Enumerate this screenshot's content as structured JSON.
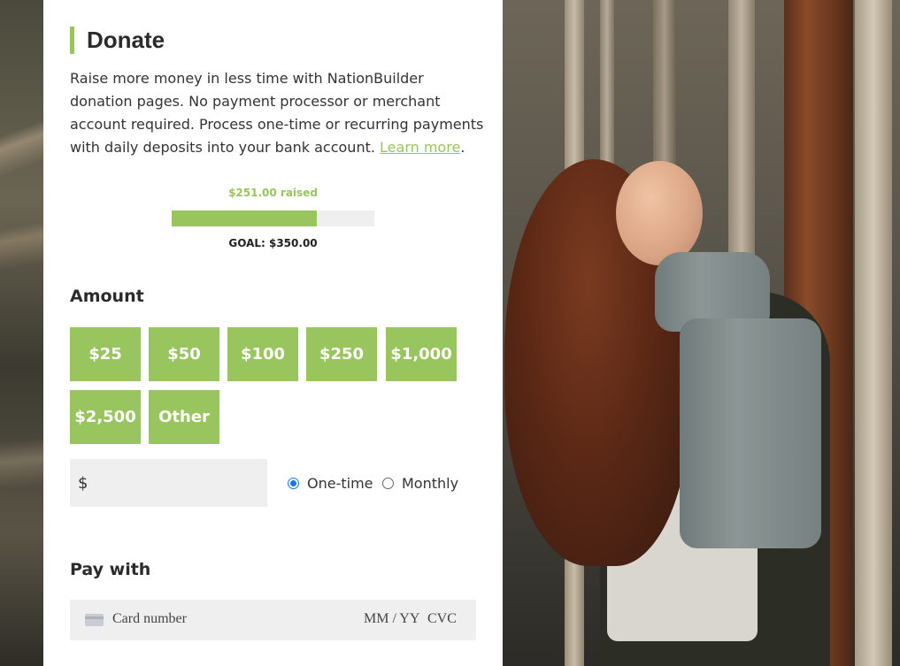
{
  "donate": {
    "title": "Donate",
    "intro_text": "Raise more money in less time with NationBuilder donation pages. No payment processor or merchant account required. Process one-time or recurring payments with daily deposits into your bank account.",
    "learn_more": "Learn more",
    "after_link": ".",
    "raised_label": "$251.00 raised",
    "goal_label": "GOAL: $350.00",
    "progress_fraction": 0.717,
    "accent_color": "#98c55e"
  },
  "amount": {
    "heading": "Amount",
    "options": [
      "$25",
      "$50",
      "$100",
      "$250",
      "$1,000",
      "$2,500",
      "Other"
    ],
    "currency_symbol": "$",
    "input_value": "",
    "frequency": {
      "options": [
        "One-time",
        "Monthly"
      ],
      "selected": "One-time"
    }
  },
  "payment": {
    "heading": "Pay with",
    "card_placeholder": "Card number",
    "expiry_placeholder": "MM / YY",
    "cvc_placeholder": "CVC",
    "card_icon": "credit-card-icon"
  },
  "photo": {
    "description_icon": "photo-woman-forest"
  }
}
